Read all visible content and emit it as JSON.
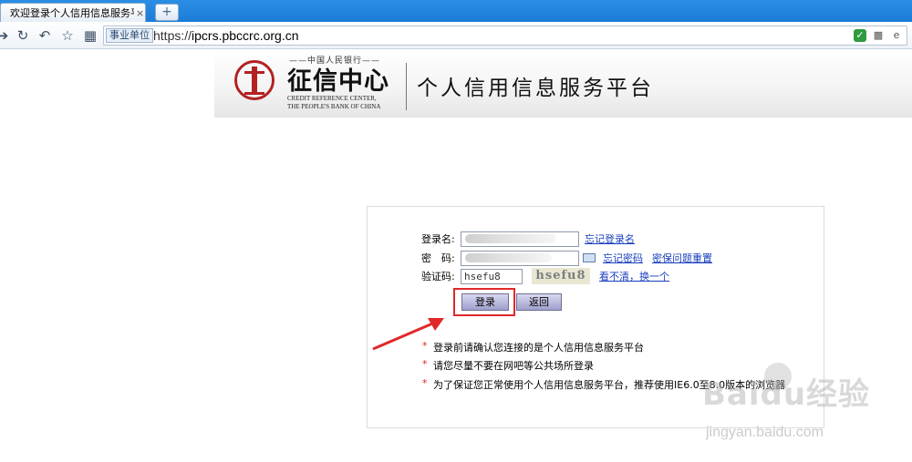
{
  "browser": {
    "tab_title": "欢迎登录个人信用信息服务平",
    "tab_close": "×",
    "new_tab": "+",
    "address_tag": "事业单位",
    "url_prefix": "https://",
    "url_host": "ipcrs.pbccrc.org.cn"
  },
  "banner": {
    "bank_name": "——中国人民银行——",
    "brand": "征信中心",
    "brand_en_line1": "CREDIT REFERENCE CENTER,",
    "brand_en_line2": "THE PEOPLE'S BANK OF CHINA",
    "platform_title": "个人信用信息服务平台"
  },
  "login": {
    "username_label": "登录名:",
    "username_value": "",
    "forgot_username": "忘记登录名",
    "password_label": "密　码:",
    "password_value": "",
    "forgot_password": "忘记密码",
    "reset_security": "密保问题重置",
    "captcha_label": "验证码:",
    "captcha_input": "hsefu8",
    "captcha_image_text": "hsefu8",
    "refresh_captcha": "看不清，换一个",
    "login_button": "登录",
    "back_button": "返回",
    "notes": [
      "登录前请确认您连接的是个人信用信息服务平台",
      "请您尽量不要在网吧等公共场所登录",
      "为了保证您正常使用个人信用信息服务平台，推荐使用IE6.0至8.0版本的浏览器"
    ],
    "note_marker": "*"
  },
  "watermark": {
    "logo": "Baidu经验",
    "site": "jingyan.baidu.com"
  },
  "colors": {
    "tabbar": "#1c7cd6",
    "highlight_box": "#e0282a",
    "link": "#1a3fbd",
    "button": "#b4b4dc"
  }
}
